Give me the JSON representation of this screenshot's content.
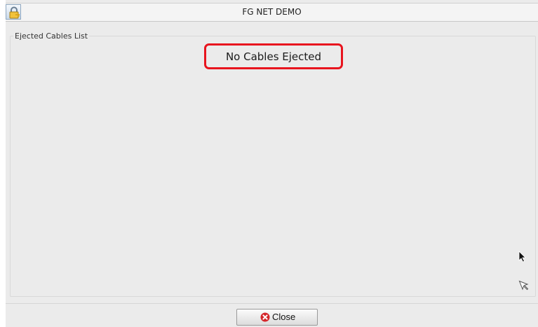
{
  "window": {
    "title": "FG NET DEMO",
    "lock_icon": "lock-key-icon"
  },
  "ejected_cables": {
    "group_label": "Ejected Cables List",
    "empty_message": "No Cables Ejected",
    "highlight_color": "#e8141e"
  },
  "footer": {
    "close_label": "Close",
    "close_icon": "close-circle-icon",
    "close_icon_color": "#d4262a"
  },
  "cursors": [
    "arrow-cursor-icon",
    "outline-arrow-cursor-icon"
  ]
}
